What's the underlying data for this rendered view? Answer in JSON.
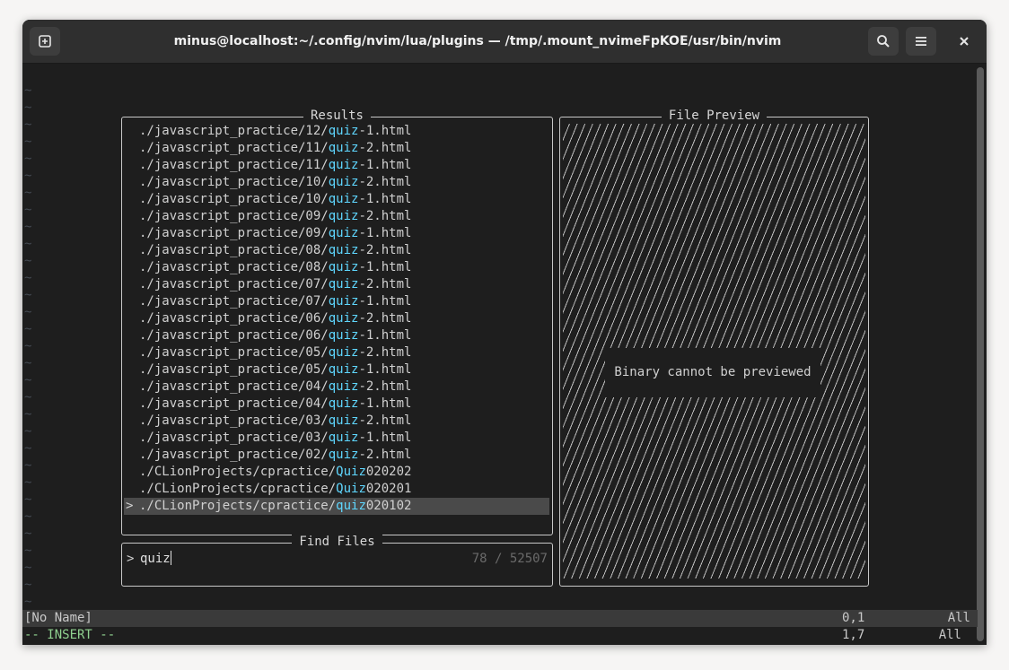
{
  "window": {
    "title": "minus@localhost:~/.config/nvim/lua/plugins — /tmp/.mount_nvimeFpKOE/usr/bin/nvim"
  },
  "titlebar": {
    "new_tab_icon": "new-tab-icon",
    "search_icon": "search-icon",
    "menu_icon": "hamburger-menu-icon",
    "close_glyph": "✕"
  },
  "editor": {
    "empty_line_marker": "~"
  },
  "telescope": {
    "results_title": "Results",
    "preview_title": "File Preview",
    "prompt_title": "Find Files",
    "selection_caret": ">",
    "results": [
      {
        "prefix": "./javascript_practice/12/",
        "match": "quiz",
        "suffix": "-1.html"
      },
      {
        "prefix": "./javascript_practice/11/",
        "match": "quiz",
        "suffix": "-2.html"
      },
      {
        "prefix": "./javascript_practice/11/",
        "match": "quiz",
        "suffix": "-1.html"
      },
      {
        "prefix": "./javascript_practice/10/",
        "match": "quiz",
        "suffix": "-2.html"
      },
      {
        "prefix": "./javascript_practice/10/",
        "match": "quiz",
        "suffix": "-1.html"
      },
      {
        "prefix": "./javascript_practice/09/",
        "match": "quiz",
        "suffix": "-2.html"
      },
      {
        "prefix": "./javascript_practice/09/",
        "match": "quiz",
        "suffix": "-1.html"
      },
      {
        "prefix": "./javascript_practice/08/",
        "match": "quiz",
        "suffix": "-2.html"
      },
      {
        "prefix": "./javascript_practice/08/",
        "match": "quiz",
        "suffix": "-1.html"
      },
      {
        "prefix": "./javascript_practice/07/",
        "match": "quiz",
        "suffix": "-2.html"
      },
      {
        "prefix": "./javascript_practice/07/",
        "match": "quiz",
        "suffix": "-1.html"
      },
      {
        "prefix": "./javascript_practice/06/",
        "match": "quiz",
        "suffix": "-2.html"
      },
      {
        "prefix": "./javascript_practice/06/",
        "match": "quiz",
        "suffix": "-1.html"
      },
      {
        "prefix": "./javascript_practice/05/",
        "match": "quiz",
        "suffix": "-2.html"
      },
      {
        "prefix": "./javascript_practice/05/",
        "match": "quiz",
        "suffix": "-1.html"
      },
      {
        "prefix": "./javascript_practice/04/",
        "match": "quiz",
        "suffix": "-2.html"
      },
      {
        "prefix": "./javascript_practice/04/",
        "match": "quiz",
        "suffix": "-1.html"
      },
      {
        "prefix": "./javascript_practice/03/",
        "match": "quiz",
        "suffix": "-2.html"
      },
      {
        "prefix": "./javascript_practice/03/",
        "match": "quiz",
        "suffix": "-1.html"
      },
      {
        "prefix": "./javascript_practice/02/",
        "match": "quiz",
        "suffix": "-2.html"
      },
      {
        "prefix": "./CLionProjects/cpractice/",
        "match": "Quiz",
        "suffix": "020202"
      },
      {
        "prefix": "./CLionProjects/cpractice/",
        "match": "Quiz",
        "suffix": "020201"
      },
      {
        "prefix": "./CLionProjects/cpractice/",
        "match": "quiz",
        "suffix": "020102",
        "selected": true
      }
    ],
    "preview_message": "Binary cannot be previewed",
    "prompt_prefix": ">",
    "prompt_value": "quiz",
    "match_count": "78 / 52507"
  },
  "statusline": {
    "filename": "[No Name]",
    "position": "0,1",
    "scroll": "All"
  },
  "cmdline": {
    "mode": "-- INSERT --",
    "position": "1,7",
    "scroll": "All"
  },
  "colors": {
    "match_highlight": "#5fd7ff",
    "mode_text": "#8fd18f",
    "selected_row": "#4a4a4a"
  }
}
